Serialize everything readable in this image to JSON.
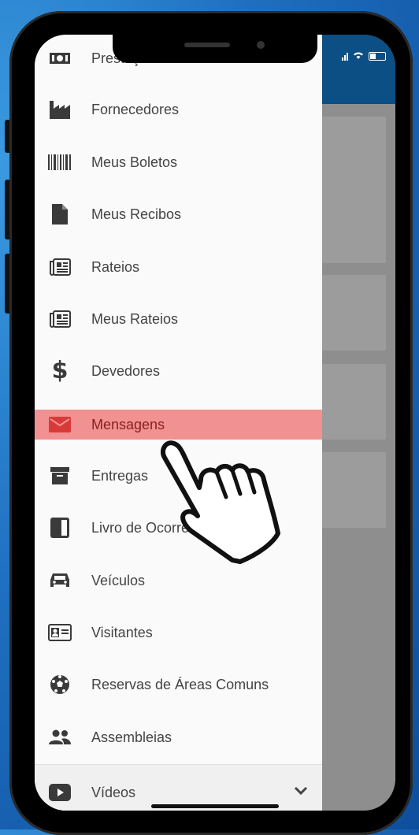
{
  "drawer": {
    "items": [
      {
        "label": "Prestações de Contas",
        "icon": "money-bill-icon"
      },
      {
        "label": "Fornecedores",
        "icon": "factory-icon"
      },
      {
        "label": "Meus Boletos",
        "icon": "barcode-icon"
      },
      {
        "label": "Meus Recibos",
        "icon": "document-icon"
      },
      {
        "label": "Rateios",
        "icon": "newspaper-icon"
      },
      {
        "label": "Meus Rateios",
        "icon": "newspaper-icon"
      },
      {
        "label": "Devedores",
        "icon": "dollar-icon"
      },
      {
        "label": "Mensagens",
        "icon": "envelope-icon",
        "active": true
      },
      {
        "label": "Entregas",
        "icon": "archive-box-icon"
      },
      {
        "label": "Livro de Ocorrências",
        "icon": "book-icon"
      },
      {
        "label": "Veículos",
        "icon": "car-icon"
      },
      {
        "label": "Visitantes",
        "icon": "id-card-icon"
      },
      {
        "label": "Reservas de Áreas Comuns",
        "icon": "soccer-ball-icon"
      },
      {
        "label": "Assembleias",
        "icon": "people-icon"
      }
    ],
    "bottom": {
      "label": "Vídeos",
      "icon": "youtube-icon",
      "expand_icon": "chevron-down-icon"
    }
  },
  "colors": {
    "header": "#0b4f85",
    "active_bg": "#f29191",
    "active_icon": "#d83a3a",
    "icon": "#3a3a3a"
  }
}
